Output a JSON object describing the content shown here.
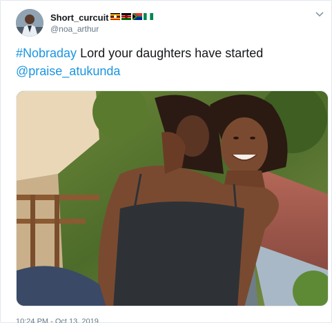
{
  "author": {
    "name": "Short_curcuit",
    "handle": "@noa_arthur",
    "avatar_icon": "profile-avatar",
    "flags": [
      "uganda-flag",
      "kenya-flag",
      "south-africa-flag",
      "nigeria-flag"
    ]
  },
  "tweet": {
    "hashtag": "#Nobraday",
    "text": " Lord your daughters have started",
    "mention": "@praise_atukunda"
  },
  "media": {
    "icon": "photo-two-women-smiling"
  },
  "footer": {
    "timestamp": "10:24 PM - Oct 13, 2019"
  },
  "menu": {
    "icon": "chevron-down-icon"
  },
  "colors": {
    "link": "#1b95e0",
    "text": "#14171a",
    "muted": "#657786",
    "border": "#e1e8ed"
  }
}
